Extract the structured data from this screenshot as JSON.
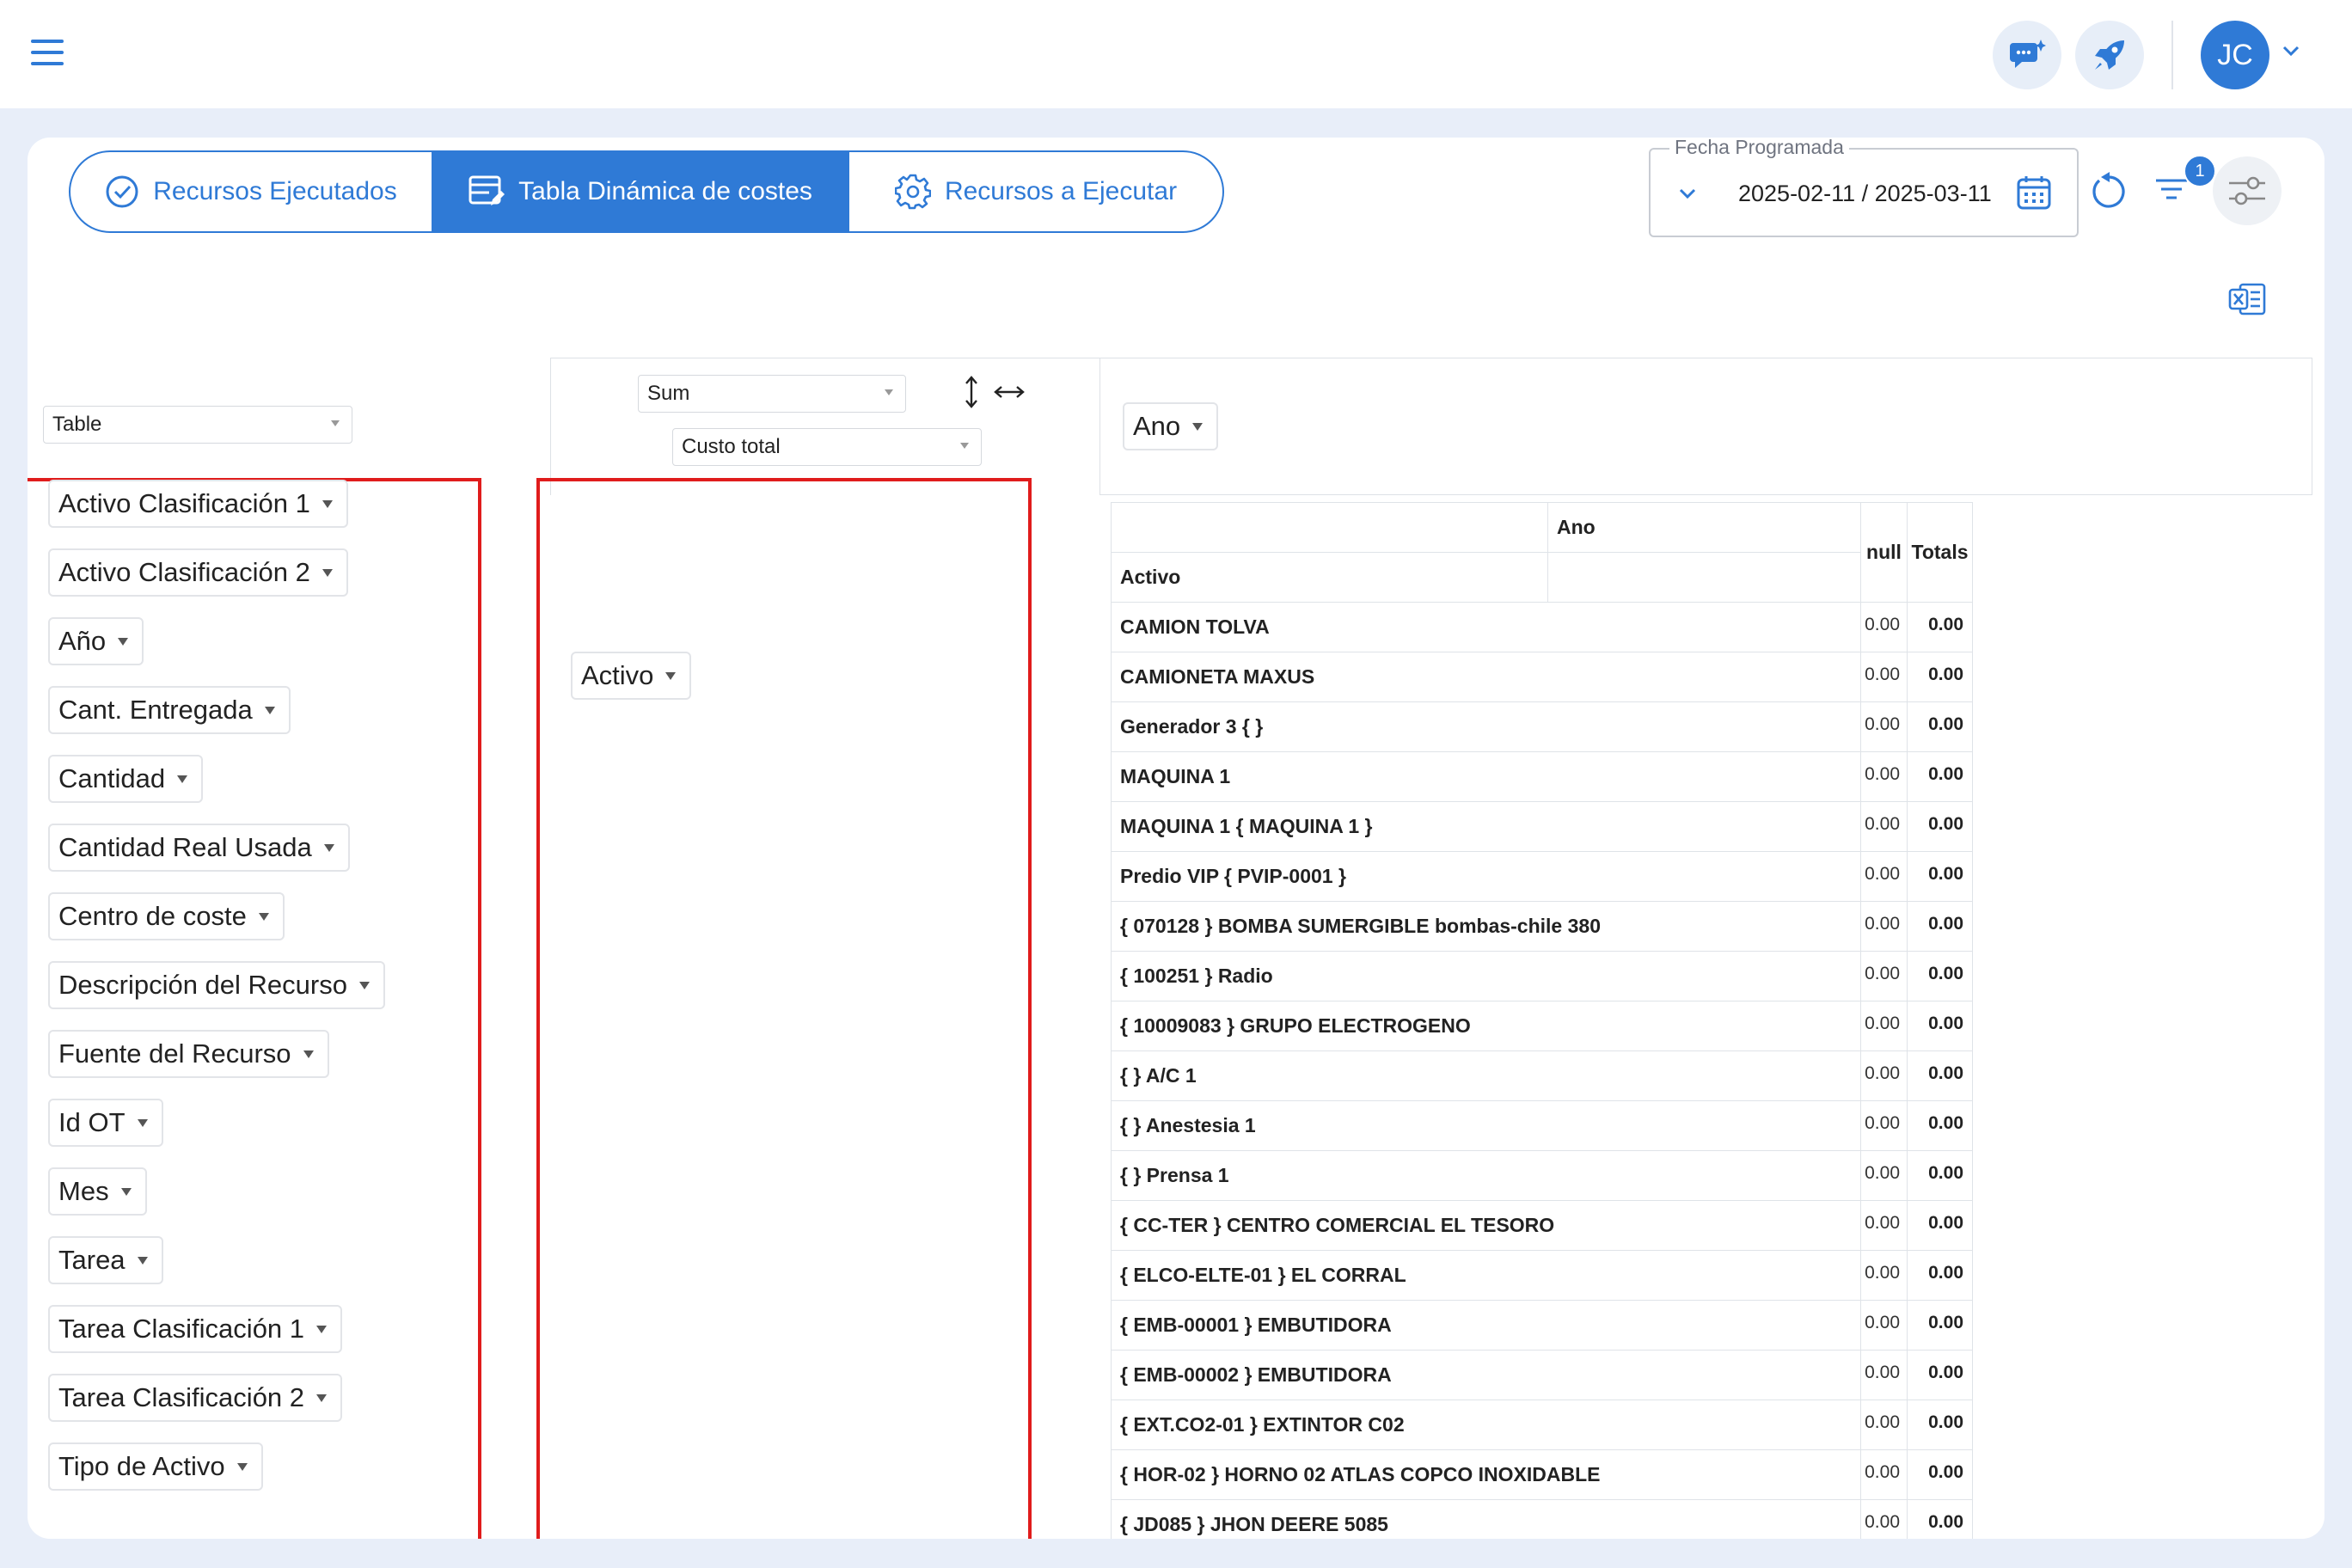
{
  "header": {
    "menu_icon": "hamburger-menu-icon",
    "chat_icon": "chat-sparkle-icon",
    "rocket_icon": "rocket-icon",
    "avatar_initials": "JC"
  },
  "tabs": [
    {
      "label": "Recursos Ejecutados",
      "icon": "check-circle-icon",
      "active": false
    },
    {
      "label": "Tabla Dinámica de costes",
      "icon": "table-edit-icon",
      "active": true
    },
    {
      "label": "Recursos a Ejecutar",
      "icon": "gear-icon",
      "active": false
    }
  ],
  "date_filter": {
    "legend": "Fecha Programada",
    "value": "2025-02-11 / 2025-03-11"
  },
  "filter_badge": "1",
  "pivot": {
    "renderer": "Table",
    "aggregator": "Sum",
    "value_field": "Custo total",
    "column_field": "Ano",
    "row_field": "Activo",
    "available_fields": [
      "Activo Clasificación 1",
      "Activo Clasificación 2",
      "Año",
      "Cant. Entregada",
      "Cantidad",
      "Cantidad Real Usada",
      "Centro de coste",
      "Descripción del Recurso",
      "Fuente del Recurso",
      "Id OT",
      "Mes",
      "Tarea",
      "Tarea Clasificación 1",
      "Tarea Clasificación 2",
      "Tipo de Activo"
    ]
  },
  "table": {
    "col_header": "Ano",
    "row_header": "Activo",
    "null_header": "null",
    "totals_header": "Totals",
    "rows": [
      {
        "label": "CAMION TOLVA",
        "value": "0.00",
        "total": "0.00"
      },
      {
        "label": "CAMIONETA MAXUS",
        "value": "0.00",
        "total": "0.00"
      },
      {
        "label": "Generador 3 { }",
        "value": "0.00",
        "total": "0.00"
      },
      {
        "label": "MAQUINA 1",
        "value": "0.00",
        "total": "0.00"
      },
      {
        "label": "MAQUINA 1 { MAQUINA 1 }",
        "value": "0.00",
        "total": "0.00"
      },
      {
        "label": "Predio VIP { PVIP-0001 }",
        "value": "0.00",
        "total": "0.00"
      },
      {
        "label": "{ 070128 } BOMBA SUMERGIBLE bombas-chile 380",
        "value": "0.00",
        "total": "0.00"
      },
      {
        "label": "{ 100251 } Radio",
        "value": "0.00",
        "total": "0.00"
      },
      {
        "label": "{ 10009083 } GRUPO ELECTROGENO",
        "value": "0.00",
        "total": "0.00"
      },
      {
        "label": "{ } A/C 1",
        "value": "0.00",
        "total": "0.00"
      },
      {
        "label": "{ } Anestesia 1",
        "value": "0.00",
        "total": "0.00"
      },
      {
        "label": "{ } Prensa 1",
        "value": "0.00",
        "total": "0.00"
      },
      {
        "label": "{ CC-TER } CENTRO COMERCIAL EL TESORO",
        "value": "0.00",
        "total": "0.00"
      },
      {
        "label": "{ ELCO-ELTE-01 } EL CORRAL",
        "value": "0.00",
        "total": "0.00"
      },
      {
        "label": "{ EMB-00001 } EMBUTIDORA",
        "value": "0.00",
        "total": "0.00"
      },
      {
        "label": "{ EMB-00002 } EMBUTIDORA",
        "value": "0.00",
        "total": "0.00"
      },
      {
        "label": "{ EXT.CO2-01 } EXTINTOR C02",
        "value": "0.00",
        "total": "0.00"
      },
      {
        "label": "{ HOR-02 } HORNO 02 ATLAS COPCO INOXIDABLE",
        "value": "0.00",
        "total": "0.00"
      },
      {
        "label": "{ JD085 } JHON DEERE 5085",
        "value": "0.00",
        "total": "0.00"
      }
    ]
  },
  "colors": {
    "primary": "#2f7ad6",
    "highlight": "#e01c1c",
    "background": "#e8eef9"
  }
}
